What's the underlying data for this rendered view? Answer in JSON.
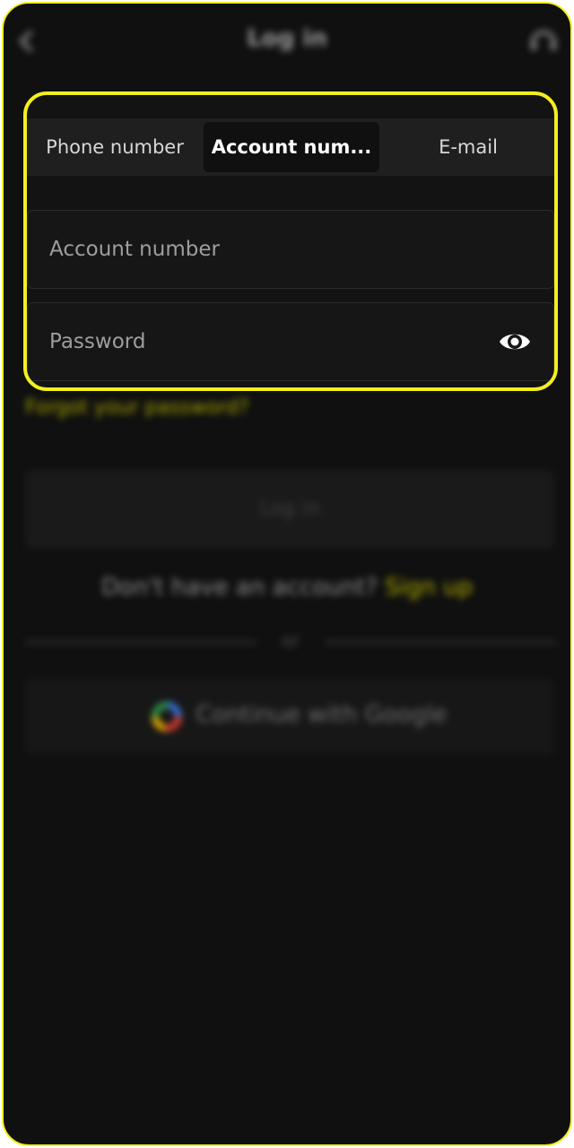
{
  "header": {
    "title": "Log in",
    "back_icon": "back-arrow-icon",
    "support_icon": "support-headset-icon"
  },
  "tabs": [
    {
      "label": "Phone number",
      "selected": false
    },
    {
      "label": "Account num...",
      "selected": true
    },
    {
      "label": "E-mail",
      "selected": false
    }
  ],
  "form": {
    "account_placeholder": "Account number",
    "password_placeholder": "Password",
    "password_toggle_icon": "eye-icon"
  },
  "links": {
    "forgot_password": "Forgot your password?"
  },
  "login_button_label": "Log in",
  "signup": {
    "prompt": "Don't have an account?",
    "link": "Sign up"
  },
  "divider_label": "or",
  "google_button": {
    "label": "Continue with Google",
    "icon": "google-icon"
  },
  "colors": {
    "highlight": "#f3ef1f",
    "background": "#101010",
    "accent_link": "#b3ae00"
  }
}
